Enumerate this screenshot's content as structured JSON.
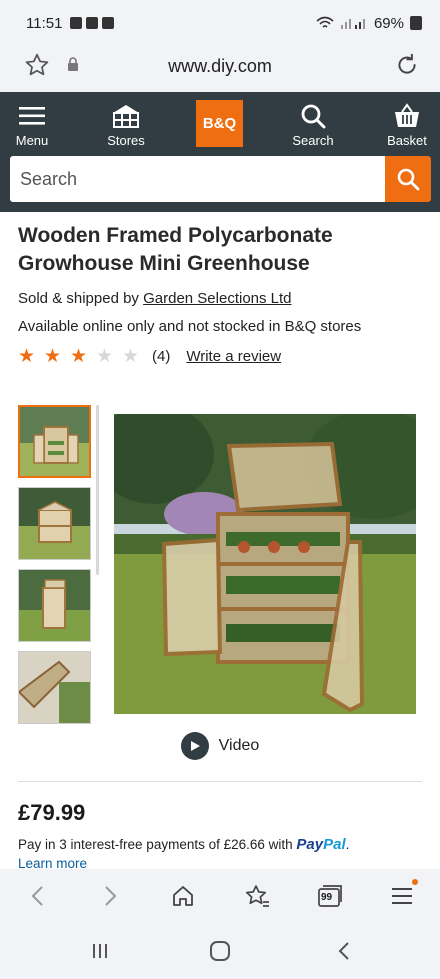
{
  "status_bar": {
    "time": "11:51",
    "battery": "69%"
  },
  "browser": {
    "url": "www.diy.com",
    "tab_count": "99"
  },
  "header": {
    "nav": {
      "menu": "Menu",
      "stores": "Stores",
      "search": "Search",
      "basket": "Basket"
    },
    "logo": "B&Q",
    "search_placeholder": "Search"
  },
  "product": {
    "title": "Wooden Framed Polycarbonate Growhouse Mini Greenhouse",
    "sold_prefix": "Sold & shipped by ",
    "seller": "Garden Selections Ltd",
    "availability": "Available online only and not stocked in B&Q stores",
    "rating": {
      "stars": 3,
      "max": 5,
      "count": "(4)",
      "write_review": "Write a review"
    },
    "video_label": "Video",
    "price": "£79.99",
    "paypal_text": "Pay in 3 interest-free payments of £26.66 with ",
    "paypal_brand_1": "Pay",
    "paypal_brand_2": "Pal",
    "paypal_suffix": ".",
    "learn_more": "Learn more"
  },
  "colors": {
    "brand_orange": "#f06e12",
    "header_dark": "#323d43"
  }
}
